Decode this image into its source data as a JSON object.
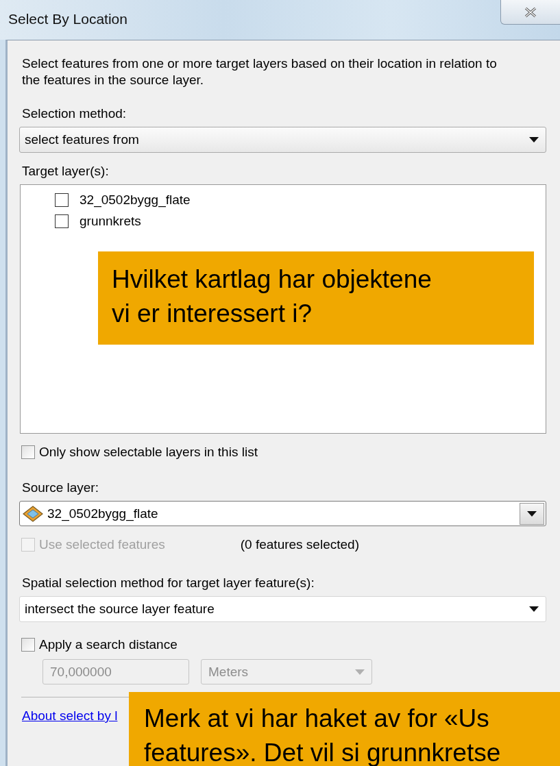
{
  "window": {
    "title": "Select By Location"
  },
  "description": "Select features from one or more target layers based on their location in relation to the features in the source layer.",
  "selection_method": {
    "label": "Selection method:",
    "value": "select features from"
  },
  "target_layers": {
    "label": "Target layer(s):",
    "items": [
      {
        "name": "32_0502bygg_flate",
        "checked": false
      },
      {
        "name": "grunnkrets",
        "checked": false
      }
    ]
  },
  "only_selectable": {
    "label": "Only show selectable layers in this list",
    "checked": false
  },
  "source_layer": {
    "label": "Source layer:",
    "value": "32_0502bygg_flate"
  },
  "use_selected": {
    "label": "Use selected features",
    "checked": false,
    "disabled": true
  },
  "selected_count": "(0 features selected)",
  "spatial_method": {
    "label": "Spatial selection method for target layer feature(s):",
    "value": "intersect the source layer feature"
  },
  "search_distance": {
    "label": "Apply a search distance",
    "checked": false,
    "disabled": true,
    "value": "70,000000",
    "unit": "Meters"
  },
  "about_link": "About select by l",
  "callouts": [
    {
      "text": "Hvilket kartlag har objektene\nvi er interessert i?"
    },
    {
      "text": "Merk at vi har haket av for «Us\nfeatures». Det vil si grunnkretse"
    }
  ]
}
